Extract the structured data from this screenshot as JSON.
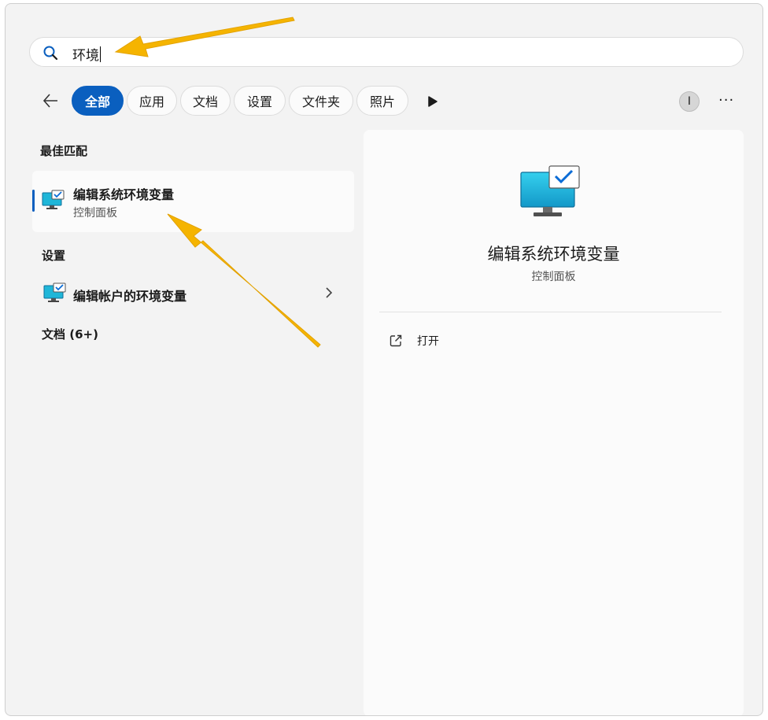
{
  "search": {
    "value": "环境"
  },
  "filters": {
    "back_icon": "arrow-left-icon",
    "tabs": [
      "全部",
      "应用",
      "文档",
      "设置",
      "文件夹",
      "照片"
    ],
    "active_tab": "全部",
    "more_icon": "play-icon",
    "avatar_letter": "I",
    "options_icon": "ellipsis-icon"
  },
  "results": {
    "best_match": {
      "heading": "最佳匹配",
      "item": {
        "title": "编辑系统环境变量",
        "subtitle": "控制面板",
        "icon": "monitor-check-icon"
      }
    },
    "settings": {
      "heading": "设置",
      "item": {
        "title": "编辑帐户的环境变量",
        "icon": "monitor-check-icon",
        "chevron": "chevron-right-icon"
      }
    },
    "documents": {
      "heading": "文档 (6+)"
    }
  },
  "detail": {
    "title": "编辑系统环境变量",
    "subtitle": "控制面板",
    "actions": [
      {
        "label": "打开",
        "icon": "open-external-icon"
      }
    ]
  },
  "colors": {
    "accent": "#0a5fbf",
    "annotation_arrow": "#f5b400",
    "monitor_screen": "#1fb6d8",
    "check": "#0a6cd6"
  }
}
